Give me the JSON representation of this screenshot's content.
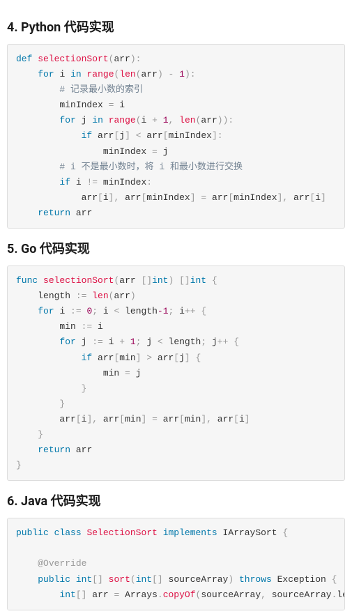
{
  "headings": {
    "python": "4. Python 代码实现",
    "go": "5. Go 代码实现",
    "java": "6. Java 代码实现"
  },
  "python": {
    "t": {
      "def": "def",
      "selectionSort": "selectionSort",
      "lp": "(",
      "arr": "arr",
      "rp": ")",
      "colon": ":",
      "for": "for",
      "i": "i",
      "in": "in",
      "range": "range",
      "len": "len",
      "minus": " - ",
      "one": "1",
      "comment1": "# 记录最小数的索引",
      "minIndex": "minIndex",
      "eq": " = ",
      "j": "j",
      "plus": " + ",
      "comma": ", ",
      "if": "if",
      "lbr": "[",
      "rbr": "]",
      "lt": " < ",
      "comment2": "# i 不是最小数时，将 i 和最小数进行交换",
      "neq": " != ",
      "return": "return"
    }
  },
  "go": {
    "t": {
      "func": "func",
      "selectionSort": "selectionSort",
      "lp": "(",
      "arr": "arr",
      "brsq": " []",
      "int": "int",
      "rp": ")",
      "sp": " ",
      "lcb": "{",
      "rcb": "}",
      "length": "length",
      "decl": " := ",
      "len": "len",
      "for": "for",
      "i": "i",
      "zero": "0",
      "semi": "; ",
      "lt": " < ",
      "minus1": "-1",
      "inc": "++",
      "min": "min",
      "j": "j",
      "plus1": " + ",
      "one": "1",
      "if": "if",
      "lbr": "[",
      "rbr": "]",
      "gt": " > ",
      "eq": " = ",
      "comma": ", ",
      "return": "return"
    }
  },
  "java": {
    "t": {
      "public": "public",
      "class": "class",
      "SelectionSort": "SelectionSort",
      "implements": "implements",
      "IArraySort": "IArraySort",
      "lcb": " {",
      "override": "@Override",
      "int": "int",
      "brsq": "[]",
      "sort": "sort",
      "lp": "(",
      "sourceArray": "sourceArray",
      "rp": ")",
      "throws": "throws",
      "Exception": "Exception",
      "arr": "arr",
      "eq": " = ",
      "Arrays": "Arrays",
      "dot": ".",
      "copyOf": "copyOf",
      "comma": ", ",
      "length": "length",
      "semi": ";"
    }
  },
  "chart_data": {
    "type": "code-listing",
    "listings": [
      {
        "language": "Python",
        "title": "4. Python 代码实现",
        "code": "def selectionSort(arr):\n    for i in range(len(arr) - 1):\n        # 记录最小数的索引\n        minIndex = i\n        for j in range(i + 1, len(arr)):\n            if arr[j] < arr[minIndex]:\n                minIndex = j\n        # i 不是最小数时，将 i 和最小数进行交换\n        if i != minIndex:\n            arr[i], arr[minIndex] = arr[minIndex], arr[i]\n    return arr"
      },
      {
        "language": "Go",
        "title": "5. Go 代码实现",
        "code": "func selectionSort(arr []int) []int {\n    length := len(arr)\n    for i := 0; i < length-1; i++ {\n        min := i\n        for j := i + 1; j < length; j++ {\n            if arr[min] > arr[j] {\n                min = j\n            }\n        }\n        arr[i], arr[min] = arr[min], arr[i]\n    }\n    return arr\n}"
      },
      {
        "language": "Java",
        "title": "6. Java 代码实现",
        "code": "public class SelectionSort implements IArraySort {\n\n    @Override\n    public int[] sort(int[] sourceArray) throws Exception {\n        int[] arr = Arrays.copyOf(sourceArray, sourceArray.length);"
      }
    ]
  }
}
